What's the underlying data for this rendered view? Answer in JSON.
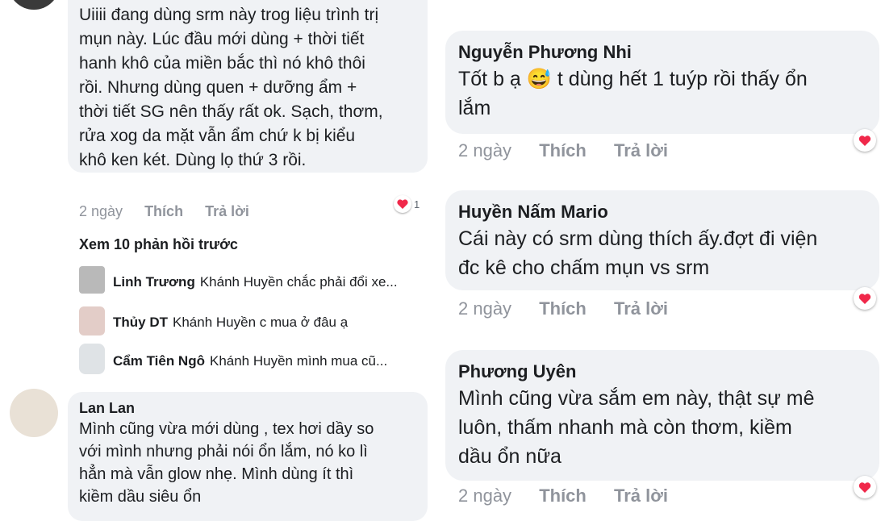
{
  "left": {
    "first_comment": {
      "text": "Uiiii đang dùng srm này trog liệu trình trị\nmụn này. Lúc đầu mới dùng + thời tiết\nhanh khô của miền bắc thì nó khô thôi\nrồi. Nhưng dùng quen + dưỡng ẩm +\nthời tiết SG nên thấy rất ok. Sạch, thơm,\nrửa xog da mặt vẫn ẩm chứ k bị kiểu\nkhô ken két. Dùng lọ thứ 3 rồi.",
      "time": "2 ngày",
      "like": "Thích",
      "reply": "Trả lời",
      "reaction_count": "1"
    },
    "view_more": "Xem 10 phản hồi trước",
    "replies": [
      {
        "name": "Linh Trương",
        "text": "Khánh Huyền chắc phải đổi xe..."
      },
      {
        "name": "Thủy DT",
        "text": "Khánh Huyền c mua ở đâu ạ"
      },
      {
        "name": "Cẩm Tiên Ngô",
        "text": "Khánh Huyền  mình mua cũ..."
      }
    ],
    "second_comment": {
      "name": "Lan Lan",
      "text": "Mình cũng vừa mới dùng , tex hơi dầy so\nvới mình nhưng phải nói ổn lắm, nó ko lì\nhẳn mà vẫn glow nhẹ. Mình dùng ít thì\nkiềm dầu siêu ổn"
    }
  },
  "right": {
    "comments": [
      {
        "name": "Nguyễn Phương Nhi",
        "text_before": "Tốt b ạ ",
        "emoji": "😅",
        "text_after": " t dùng hết 1 tuýp rồi thấy ổn\nlắm",
        "time": "2 ngày",
        "like": "Thích",
        "reply": "Trả lời"
      },
      {
        "name": "Huyền Nấm Mario",
        "text": "Cái này có srm dùng thích ấy.đợt đi viện\nđc kê cho chấm mụn vs srm",
        "time": "2 ngày",
        "like": "Thích",
        "reply": "Trả lời"
      },
      {
        "name": "Phương Uyên",
        "text": "Mình cũng vừa sắm em này, thật sự mê\nluôn, thấm nhanh mà còn thơm, kiềm\ndầu ổn nữa",
        "time": "2 ngày",
        "like": "Thích",
        "reply": "Trả lời"
      }
    ]
  },
  "colors": {
    "bubble": "#f0f2f5",
    "meta": "#90949c",
    "heart": "#f0284a"
  }
}
